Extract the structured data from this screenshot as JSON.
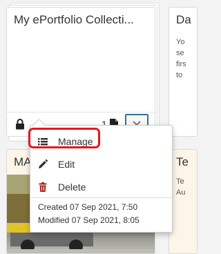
{
  "collection_card": {
    "title": "My ePortfolio Collecti...",
    "page_count": "1",
    "icons": {
      "lock": "lock-icon",
      "pages": "document-icon",
      "toggle": "chevron-down-icon"
    }
  },
  "right_card_top": {
    "title": "Da",
    "description_lines": [
      "Yo",
      "se",
      "firs",
      "to"
    ]
  },
  "bottom_left_card": {
    "title": "MA"
  },
  "bottom_right_card": {
    "title": "Te",
    "description_lines": [
      "Te",
      "Au"
    ]
  },
  "dropdown": {
    "items": [
      {
        "label": "Manage",
        "icon": "list-icon"
      },
      {
        "label": "Edit",
        "icon": "pencil-icon"
      },
      {
        "label": "Delete",
        "icon": "trash-icon"
      }
    ],
    "created": "Created 07 Sep 2021, 7:50",
    "modified": "Modified 07 Sep 2021, 8:05",
    "highlight_color": "#e8141c"
  },
  "colors": {
    "accent_border": "#2f6f9f",
    "card_bg": "#ffffff",
    "warm_card_bg": "#fcf5e8"
  }
}
